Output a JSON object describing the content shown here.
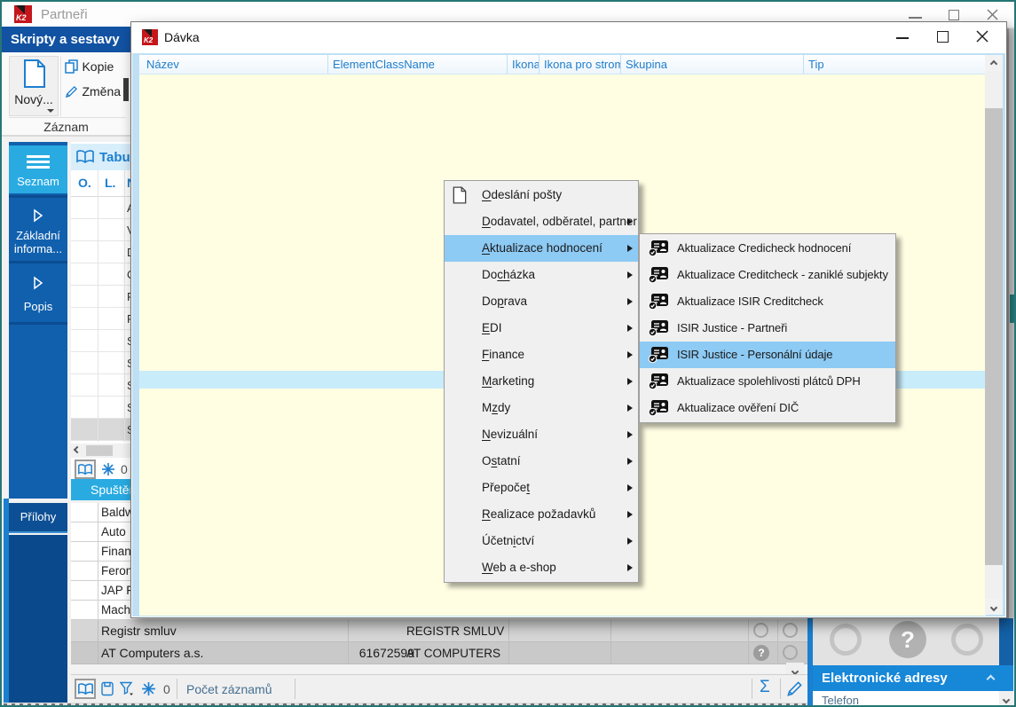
{
  "window": {
    "title": "Partneři",
    "ribbon": {
      "tab": "Skripty a sestavy",
      "new": "Nový...",
      "copy": "Kopie",
      "change": "Změna",
      "group": "Záznam"
    },
    "sidebar": {
      "tabs": [
        {
          "id": "seznam",
          "label": "Seznam"
        },
        {
          "id": "zakladni-informace",
          "label": "Základní informa..."
        },
        {
          "id": "popis",
          "label": "Popis"
        }
      ],
      "attachments": "Přílohy"
    },
    "table_panel": {
      "title": "Tabulka",
      "columns": [
        "O.",
        "L.",
        "N"
      ],
      "rows": [
        "A",
        "V",
        "D",
        "O",
        "F",
        "F",
        "S",
        "S",
        "S",
        "S",
        "S"
      ],
      "frozen_count": "0",
      "run_button": "Spuštění"
    },
    "partners": {
      "rows_partial": [
        "Baldw",
        "Auto",
        "Finan",
        "Feron",
        "JAP F",
        "Mach"
      ],
      "rows": [
        {
          "name": "Registr smluv",
          "ico": "",
          "short_name": "REGISTR SMLUV",
          "has_question": false
        },
        {
          "name": "AT Computers a.s.",
          "ico": "61672599",
          "short_name": "AT COMPUTERS",
          "has_question": true
        }
      ]
    },
    "status_bar": {
      "frozen_count": "0",
      "records_label": "Počet záznamů",
      "sum": "Σ"
    },
    "right_panel": {
      "question": "?",
      "header": "Elektronické adresy",
      "row": "Telefon"
    }
  },
  "dialog": {
    "title": "Dávka",
    "columns": [
      "Název",
      "ElementClassName",
      "Ikona",
      "Ikona pro strom",
      "Skupina",
      "Tip"
    ]
  },
  "context_menu": {
    "items": [
      {
        "id": "odeslani-posty",
        "pre": "",
        "acc": "O",
        "post": "deslání pošty",
        "icon": "document",
        "arrow": false,
        "highlighted": false
      },
      {
        "id": "dodavatel-odberatel-partner",
        "pre": "",
        "acc": "D",
        "post": "odavatel, odběratel, partner",
        "icon": "",
        "arrow": true,
        "highlighted": false
      },
      {
        "id": "aktualizace-hodnoceni",
        "pre": "",
        "acc": "A",
        "post": "ktualizace hodnocení",
        "icon": "",
        "arrow": true,
        "highlighted": true
      },
      {
        "id": "dochazka",
        "pre": "Do",
        "acc": "ch",
        "post": "ázka",
        "icon": "",
        "arrow": true,
        "highlighted": false
      },
      {
        "id": "doprava",
        "pre": "Do",
        "acc": "p",
        "post": "rava",
        "icon": "",
        "arrow": true,
        "highlighted": false
      },
      {
        "id": "edi",
        "pre": "",
        "acc": "E",
        "post": "DI",
        "icon": "",
        "arrow": true,
        "highlighted": false
      },
      {
        "id": "finance",
        "pre": "",
        "acc": "F",
        "post": "inance",
        "icon": "",
        "arrow": true,
        "highlighted": false
      },
      {
        "id": "marketing",
        "pre": "",
        "acc": "M",
        "post": "arketing",
        "icon": "",
        "arrow": true,
        "highlighted": false
      },
      {
        "id": "mzdy",
        "pre": "M",
        "acc": "z",
        "post": "dy",
        "icon": "",
        "arrow": true,
        "highlighted": false
      },
      {
        "id": "nevizualni",
        "pre": "",
        "acc": "N",
        "post": "evizuální",
        "icon": "",
        "arrow": true,
        "highlighted": false
      },
      {
        "id": "ostatni",
        "pre": "O",
        "acc": "s",
        "post": "tatní",
        "icon": "",
        "arrow": true,
        "highlighted": false
      },
      {
        "id": "prepocet",
        "pre": "Přepoče",
        "acc": "t",
        "post": "",
        "icon": "",
        "arrow": true,
        "highlighted": false
      },
      {
        "id": "realizace-pozadavku",
        "pre": "",
        "acc": "R",
        "post": "ealizace požadavků",
        "icon": "",
        "arrow": true,
        "highlighted": false
      },
      {
        "id": "ucetnictvi",
        "pre": "Účetn",
        "acc": "i",
        "post": "ctví",
        "icon": "",
        "arrow": true,
        "highlighted": false
      },
      {
        "id": "web-a-eshop",
        "pre": "",
        "acc": "W",
        "post": "eb a e-shop",
        "icon": "",
        "arrow": true,
        "highlighted": false
      }
    ]
  },
  "submenu": {
    "items": [
      {
        "id": "aktualizace-credicheck-hodnoceni",
        "label": "Aktualizace Credicheck hodnocení",
        "highlighted": false
      },
      {
        "id": "aktualizace-creditcheck-zanikle-subjekty",
        "label": "Aktualizace Creditcheck - zaniklé subjekty",
        "highlighted": false
      },
      {
        "id": "aktualizace-isir-creditcheck",
        "label": "Aktualizace ISIR Creditcheck",
        "highlighted": false
      },
      {
        "id": "isir-justice-partneri",
        "label": "ISIR Justice - Partneři",
        "highlighted": false
      },
      {
        "id": "isir-justice-personalni-udaje",
        "label": "ISIR Justice - Personální údaje",
        "highlighted": true
      },
      {
        "id": "aktualizace-spolehlivosti-platcu-dph",
        "label": "Aktualizace spolehlivosti plátců DPH",
        "highlighted": false
      },
      {
        "id": "aktualizace-overeni-dic",
        "label": "Aktualizace ověření DIČ",
        "highlighted": false
      }
    ]
  },
  "colors": {
    "k2_red": "#c4161c",
    "accent_blue": "#1c7fd0",
    "ribbon_header_blue": "#1252a2",
    "tab_cyan": "#29abe2",
    "menu_highlight": "#8dcaf4",
    "dialog_client": "#fffee3",
    "selection_band": "#c9ecfb",
    "teal_frame": "#267676"
  }
}
